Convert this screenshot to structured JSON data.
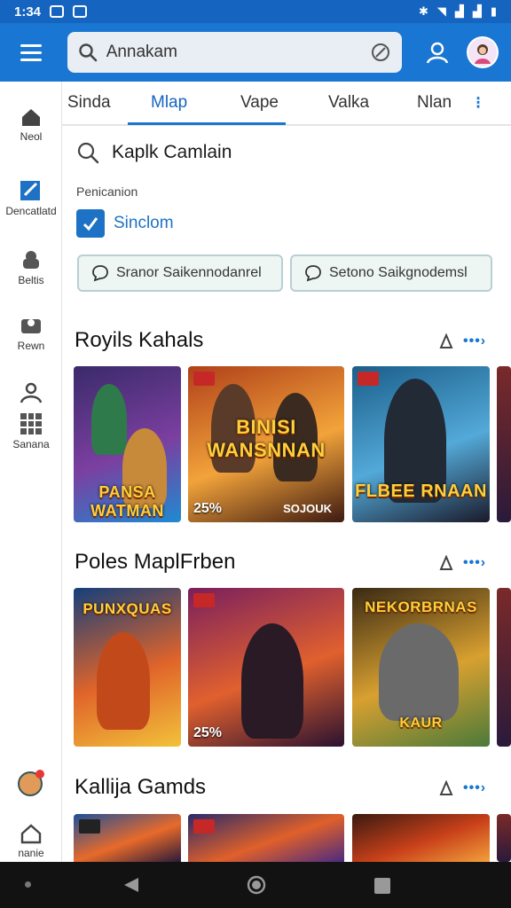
{
  "status_bar": {
    "time": "1:34"
  },
  "app_bar": {
    "search_value": "Annakam"
  },
  "tabs": [
    "Sinda",
    "Mlap",
    "Vape",
    "Valka",
    "Nlan"
  ],
  "active_tab": 1,
  "rail": [
    {
      "label": "Neol"
    },
    {
      "label": "Dencatlatd"
    },
    {
      "label": "Beltis"
    },
    {
      "label": "Rewn"
    },
    {
      "label": "Sanana"
    },
    {
      "label": "nanie"
    }
  ],
  "filters": {
    "search_text": "Kaplk Camlain",
    "caption": "Penicanion",
    "checkbox_label": "Sinclom",
    "chips": [
      "Sranor Saikennodanrel",
      "Setono Saikgnodemsl"
    ]
  },
  "sections": [
    {
      "title": "Royils Kahals",
      "cards": [
        {
          "title": "PANSA WATMAN",
          "discount": "",
          "colors": [
            "#3a2a6a",
            "#7b3fa0",
            "#1f8ad1"
          ]
        },
        {
          "title": "BINISI WANSNNAN",
          "discount": "25%",
          "sub": "SOJOUK",
          "colors": [
            "#b0401a",
            "#f2a33a",
            "#3d1a12"
          ]
        },
        {
          "title": "FLBEE RNAAN",
          "discount": "",
          "colors": [
            "#1b5e8a",
            "#53a9d8",
            "#1a1a2a"
          ]
        }
      ]
    },
    {
      "title": "Poles MaplFrben",
      "cards": [
        {
          "title": "PUNXQUAS",
          "discount": "",
          "colors": [
            "#153f7a",
            "#e0642a",
            "#f2c23a"
          ]
        },
        {
          "title": "",
          "discount": "25%",
          "colors": [
            "#7a1f5e",
            "#e0602e",
            "#2a1230"
          ]
        },
        {
          "title": "NEKORBRNAS",
          "discount": "",
          "sub": "KAUR",
          "colors": [
            "#3a2a14",
            "#d8a030",
            "#4a7a3a"
          ]
        }
      ]
    },
    {
      "title": "Kallija Gamds",
      "cards": [
        {
          "title": "",
          "discount": "",
          "colors": [
            "#1d4f9a",
            "#e86a2a",
            "#2a1a3a"
          ]
        },
        {
          "title": "",
          "discount": "",
          "colors": [
            "#2a2a6a",
            "#e0602a",
            "#4a2a80"
          ]
        },
        {
          "title": "",
          "discount": "",
          "colors": [
            "#3a1a10",
            "#c8401a",
            "#f2a03a"
          ]
        }
      ]
    }
  ],
  "colors": {
    "accent": "#1976d2",
    "appbar": "#1976d2",
    "statusbar": "#1565c0"
  }
}
